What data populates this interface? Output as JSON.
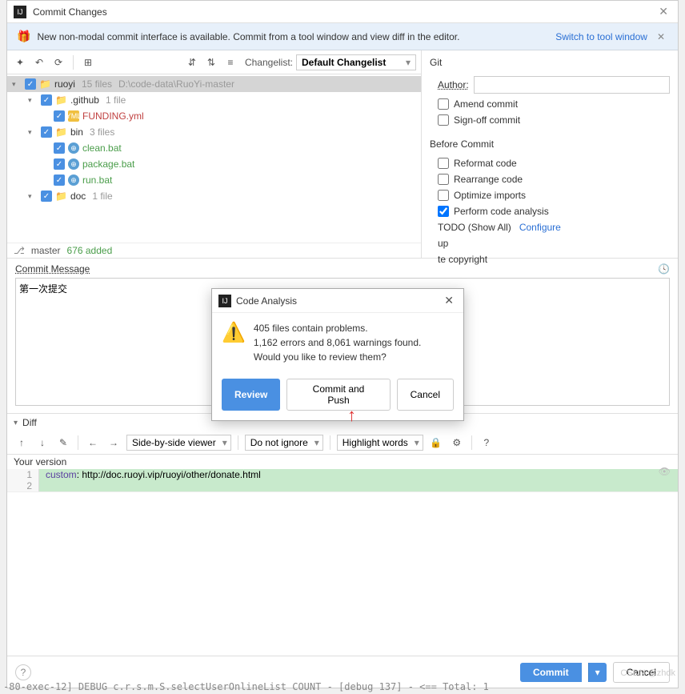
{
  "titlebar": {
    "title": "Commit Changes"
  },
  "banner": {
    "message": "New non-modal commit interface is available. Commit from a tool window and view diff in the editor.",
    "link": "Switch to tool window"
  },
  "toolbar": {
    "changelist_label": "Changelist:",
    "changelist_value": "Default Changelist"
  },
  "tree": {
    "root": {
      "name": "ruoyi",
      "meta": "15 files",
      "path": "D:\\code-data\\RuoYi-master"
    },
    "github": {
      "name": ".github",
      "meta": "1 file"
    },
    "funding": {
      "name": "FUNDING.yml"
    },
    "bin": {
      "name": "bin",
      "meta": "3 files"
    },
    "clean": {
      "name": "clean.bat"
    },
    "package": {
      "name": "package.bat"
    },
    "run": {
      "name": "run.bat"
    },
    "doc": {
      "name": "doc",
      "meta": "1 file"
    }
  },
  "status": {
    "branch": "master",
    "added": "676 added"
  },
  "commit_message": {
    "label": "Commit Message",
    "text": "第一次提交"
  },
  "git_panel": {
    "title": "Git",
    "author_label": "Author:",
    "amend": "Amend commit",
    "signoff": "Sign-off commit",
    "before_commit": "Before Commit",
    "reformat": "Reformat code",
    "rearrange": "Rearrange code",
    "optimize": "Optimize imports",
    "analysis": "Perform code analysis",
    "todo": "TODO (Show All)",
    "configure": "Configure",
    "cleanup": "up",
    "copyright": "te copyright"
  },
  "diff": {
    "label": "Diff",
    "viewer": "Side-by-side viewer",
    "ignore": "Do not ignore",
    "highlight": "Highlight words",
    "version": "Your version",
    "line1_kw": "custom",
    "line1_rest": ": http://doc.ruoyi.vip/ruoyi/other/donate.html"
  },
  "buttons": {
    "commit": "Commit",
    "cancel": "Cancel"
  },
  "modal": {
    "title": "Code Analysis",
    "line1": "405 files contain problems.",
    "line2": "1,162 errors and 8,061 warnings found.",
    "line3": "Would you like to review them?",
    "review": "Review",
    "commit_push": "Commit and Push",
    "cancel": "Cancel"
  },
  "watermark": "CSDN @zhdk",
  "debug_line": "-80-exec-12] DEBUG c.r.s.m.S.selectUserOnlineList COUNT - [debug 137] - <==    Total: 1"
}
